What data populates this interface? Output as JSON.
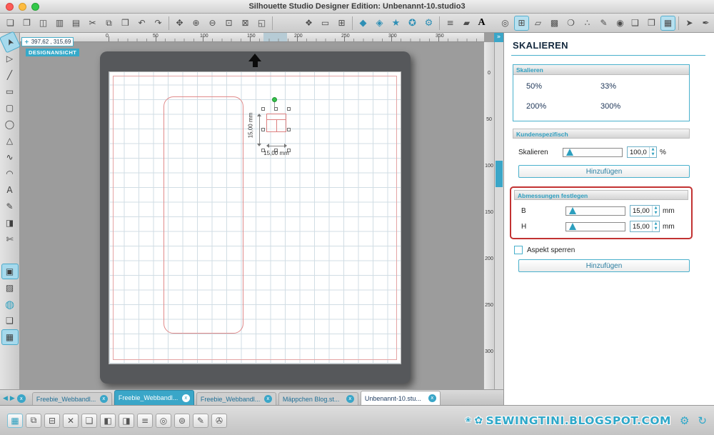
{
  "window": {
    "title": "Silhouette Studio Designer Edition: Unbenannt-10.studio3"
  },
  "ui": {
    "close_glyph": "x",
    "collapse_glyph": "»",
    "nav_left": "◀",
    "nav_right": "▶",
    "spin_up": "▲",
    "spin_down": "▼",
    "crosshair": "+"
  },
  "toolbar_top": {
    "file_icons": [
      {
        "name": "new-document-icon",
        "glyph": "❏"
      },
      {
        "name": "open-document-icon",
        "glyph": "❐"
      },
      {
        "name": "save-document-icon",
        "glyph": "◫"
      },
      {
        "name": "save-to-library-icon",
        "glyph": "▥"
      },
      {
        "name": "print-icon",
        "glyph": "▤"
      },
      {
        "name": "cut-icon",
        "glyph": "✂"
      },
      {
        "name": "copy-icon",
        "glyph": "⧉"
      },
      {
        "name": "paste-icon",
        "glyph": "❒"
      },
      {
        "name": "undo-icon",
        "glyph": "↶"
      },
      {
        "name": "redo-icon",
        "glyph": "↷"
      }
    ],
    "view_icons": [
      {
        "name": "pan-tool-icon",
        "glyph": "✥"
      },
      {
        "name": "zoom-in-icon",
        "glyph": "⊕"
      },
      {
        "name": "zoom-out-icon",
        "glyph": "⊖"
      },
      {
        "name": "zoom-selection-icon",
        "glyph": "⊡"
      },
      {
        "name": "drag-zoom-icon",
        "glyph": "⊠"
      },
      {
        "name": "fit-to-window-icon",
        "glyph": "◱"
      }
    ],
    "page_icons": [
      {
        "name": "trace-icon",
        "glyph": "❖"
      },
      {
        "name": "page-setup-icon",
        "glyph": "▭"
      },
      {
        "name": "registration-marks-icon",
        "glyph": "⊞"
      }
    ],
    "shape_icons": [
      {
        "name": "diamond-shape-icon",
        "glyph": "◆"
      },
      {
        "name": "pentagon-shape-icon",
        "glyph": "◈"
      },
      {
        "name": "star-shape-icon",
        "glyph": "★"
      },
      {
        "name": "seal-shape-icon",
        "glyph": "✪"
      },
      {
        "name": "gear-shape-icon",
        "glyph": "⚙"
      }
    ],
    "style_icons": [
      {
        "name": "line-style-icon",
        "glyph": "≡"
      },
      {
        "name": "fill-style-icon",
        "glyph": "▰"
      }
    ],
    "text_icons": [
      {
        "name": "text-style-icon",
        "glyph": "A",
        "cls": "letterA"
      }
    ],
    "designer_icons": [
      {
        "name": "offset-panel-icon",
        "glyph": "◎"
      },
      {
        "name": "scale-panel-icon",
        "glyph": "⊞",
        "active": true
      },
      {
        "name": "shear-panel-icon",
        "glyph": "▱"
      },
      {
        "name": "nesting-panel-icon",
        "glyph": "▩"
      },
      {
        "name": "shadow-panel-icon",
        "glyph": "❍"
      },
      {
        "name": "rhinestone-panel-icon",
        "glyph": "∴"
      },
      {
        "name": "sketch-panel-icon",
        "glyph": "✎"
      },
      {
        "name": "weld-panel-icon",
        "glyph": "◉"
      }
    ],
    "view_panel_icons": [
      {
        "name": "design-view-icon",
        "glyph": "❑"
      },
      {
        "name": "library-view-icon",
        "glyph": "❒"
      },
      {
        "name": "store-view-icon",
        "glyph": "▦",
        "active": true
      }
    ],
    "right_icons": [
      {
        "name": "cursor-tool-icon",
        "glyph": "➤"
      },
      {
        "name": "pen-tool-icon",
        "glyph": "✒"
      }
    ]
  },
  "toolbar_left": {
    "tools": [
      {
        "name": "select-tool-icon",
        "glyph": "➤",
        "active": true,
        "cls": "rot"
      },
      {
        "name": "edit-points-tool-icon",
        "glyph": "▷"
      },
      {
        "name": "line-tool-icon",
        "glyph": "╱"
      },
      {
        "name": "rectangle-tool-icon",
        "glyph": "▭"
      },
      {
        "name": "rounded-rectangle-tool-icon",
        "glyph": "▢"
      },
      {
        "name": "ellipse-tool-icon",
        "glyph": "◯"
      },
      {
        "name": "polygon-tool-icon",
        "glyph": "△"
      },
      {
        "name": "curve-tool-icon",
        "glyph": "∿"
      },
      {
        "name": "arc-tool-icon",
        "glyph": "◠"
      },
      {
        "name": "text-tool-icon",
        "glyph": "A",
        "cls": "letterA"
      },
      {
        "name": "freehand-tool-icon",
        "glyph": "✎"
      },
      {
        "name": "eraser-tool-icon",
        "glyph": "◨"
      },
      {
        "name": "knife-tool-icon",
        "glyph": "✄"
      }
    ],
    "panels": [
      {
        "name": "flat-view-icon",
        "glyph": "▣",
        "active": true
      },
      {
        "name": "image-effects-icon",
        "glyph": "▨"
      },
      {
        "name": "online-store-icon",
        "glyph": "◍",
        "cls": "globe"
      },
      {
        "name": "page-thumbnail-icon",
        "glyph": "❑"
      },
      {
        "name": "grid-view-icon",
        "glyph": "▦",
        "active": true
      }
    ]
  },
  "canvas": {
    "coords": "397,62 , 315,69",
    "view_badge": "DESIGNANSICHT",
    "ruler_h": [
      "0",
      "50",
      "100",
      "150",
      "200",
      "250",
      "300",
      "350"
    ],
    "ruler_v": [
      "0",
      "50",
      "100",
      "150",
      "200",
      "250",
      "300"
    ],
    "dim_height_label": "15,00 mm",
    "dim_width_label": "15,00 mm"
  },
  "panel": {
    "title": "SKALIEREN",
    "group1_header": "Skalieren",
    "presets": [
      "50%",
      "33%",
      "200%",
      "300%"
    ],
    "custom_header": "Kundenspezifisch",
    "scale_label": "Skalieren",
    "scale_value": "100,0",
    "scale_unit": "%",
    "add_button1": "Hinzufügen",
    "dims_header": "Abmessungen festlegen",
    "w_label": "B",
    "w_value": "15,00",
    "w_unit": "mm",
    "h_label": "H",
    "h_value": "15,00",
    "h_unit": "mm",
    "aspect_label": "Aspekt sperren",
    "add_button2": "Hinzufügen"
  },
  "tabs": [
    {
      "label": "Freebie_Webbandl..."
    },
    {
      "label": "Freebie_Webbandl...",
      "cls": "t-sel"
    },
    {
      "label": "Freebie_Webbandl..."
    },
    {
      "label": "Mäppchen Blog.st..."
    },
    {
      "label": "Unbenannt-10.stu...",
      "cls": "t-active"
    }
  ],
  "toolbar_bottom": {
    "icons": [
      {
        "name": "grid-toggle-icon",
        "glyph": "▦",
        "cls": "teal"
      },
      {
        "name": "group-icon",
        "glyph": "⧉"
      },
      {
        "name": "ungroup-icon",
        "glyph": "⊟"
      },
      {
        "name": "delete-icon",
        "glyph": "✕"
      },
      {
        "name": "duplicate-icon",
        "glyph": "❏"
      },
      {
        "name": "bring-to-front-icon",
        "glyph": "◧"
      },
      {
        "name": "send-to-back-icon",
        "glyph": "◨"
      },
      {
        "name": "align-icon",
        "glyph": "≡"
      },
      {
        "name": "weld-icon",
        "glyph": "◎"
      },
      {
        "name": "offset-icon",
        "glyph": "⊚"
      },
      {
        "name": "sketch-pen-icon",
        "glyph": "✎"
      },
      {
        "name": "attach-media-icon",
        "glyph": "✇"
      }
    ]
  },
  "footer": {
    "flower1": "✿",
    "flower2": "❀",
    "watermark": "SEWINGTINI.BLOGSPOT.COM",
    "gear_glyph": "⚙",
    "refresh_glyph": "↻"
  },
  "colors": {
    "accent": "#3aa6c8",
    "cut_line": "#e08a8a",
    "annotation_red": "#c23232",
    "handle_green": "#35c24a"
  }
}
